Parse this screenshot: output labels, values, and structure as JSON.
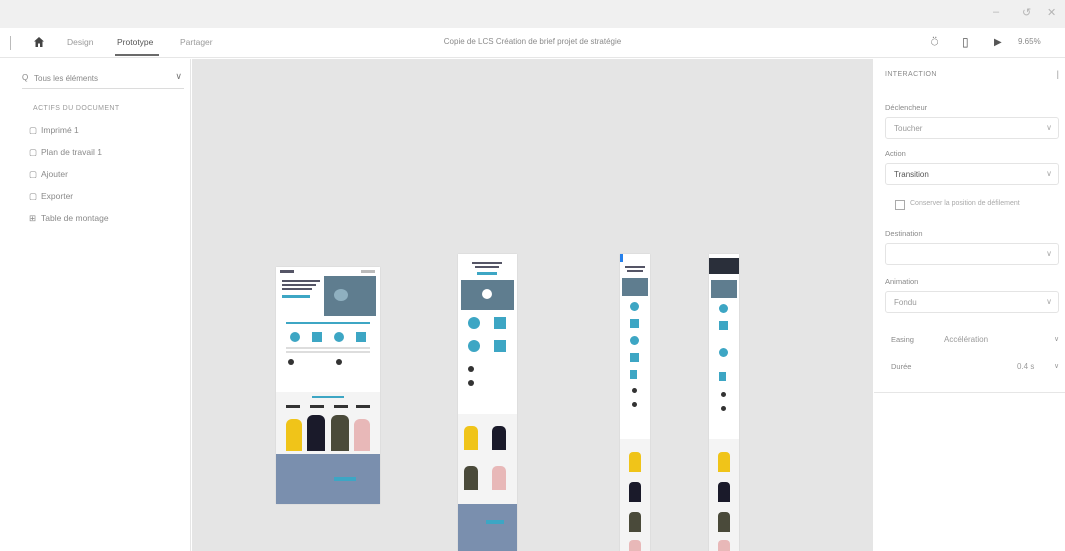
{
  "window": {
    "minimize": "–",
    "maximize": "▫",
    "close": "✕",
    "restore": "↺"
  },
  "topbar": {
    "modes": [
      "Design",
      "Prototype",
      "Partager"
    ],
    "active_mode": "Prototype",
    "document_title": "Copie de LCS Création de brief projet de stratégie",
    "zoom": "9.65%"
  },
  "left_panel": {
    "search_placeholder": "Tous les éléments",
    "section_label": "ACTIFS DU DOCUMENT",
    "assets": [
      {
        "icon": "▢",
        "label": "Imprimé 1"
      },
      {
        "icon": "▢",
        "label": "Plan de travail 1"
      },
      {
        "icon": "▢",
        "label": "Ajouter"
      },
      {
        "icon": "▢",
        "label": "Exporter"
      },
      {
        "icon": "⊞",
        "label": "Table de montage"
      }
    ]
  },
  "right_panel": {
    "title": "INTERACTION",
    "fields": [
      {
        "label": "Déclencheur",
        "value": "Toucher"
      },
      {
        "label": "Action",
        "value": "Transition"
      },
      {
        "label": "Destination",
        "value": ""
      },
      {
        "label": "Animation",
        "value": "Fondu"
      }
    ],
    "checkbox_label": "Conserver la position de défilement",
    "easing_label": "Easing",
    "easing_value": "Accélération",
    "duration_label": "Durée",
    "duration_value": "0.4 s"
  },
  "colors": {
    "accent": "#2680eb",
    "teal": "#3da6c4",
    "hero": "#5f7d8f",
    "band": "#7a8fae",
    "yellow": "#f0c419"
  }
}
